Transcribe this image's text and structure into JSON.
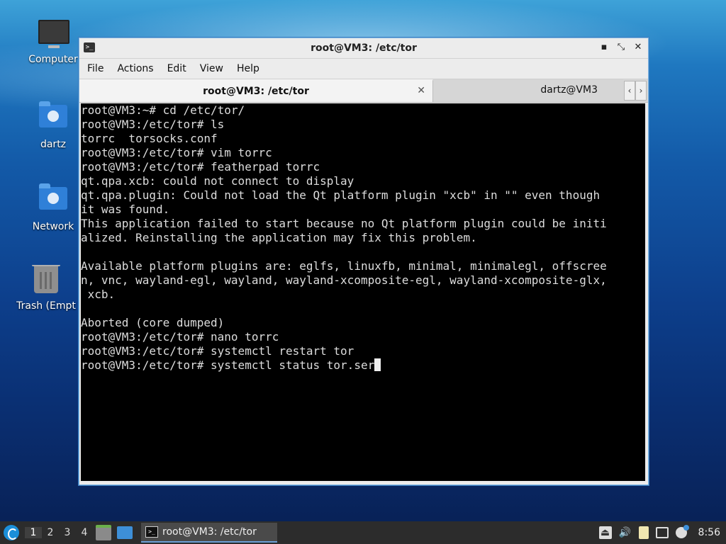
{
  "desktop": {
    "icons": [
      {
        "label": "Computer",
        "icon": "computer-icon"
      },
      {
        "label": "dartz",
        "icon": "home-folder-icon"
      },
      {
        "label": "Network",
        "icon": "network-folder-icon"
      },
      {
        "label": "Trash (Empt",
        "icon": "trash-icon"
      }
    ]
  },
  "window": {
    "title": "root@VM3: /etc/tor",
    "title_icon": ">_",
    "controls": {
      "minimize": "▪",
      "maximize": "⤡",
      "close": "✕"
    },
    "menu": [
      "File",
      "Actions",
      "Edit",
      "View",
      "Help"
    ],
    "tabs": [
      {
        "label": "root@VM3: /etc/tor",
        "close": "✕",
        "active": true
      },
      {
        "label": "dartz@VM3",
        "active": false
      }
    ],
    "tab_scroll": {
      "left": "‹",
      "right": "›"
    }
  },
  "terminal": {
    "lines": [
      "root@VM3:~# cd /etc/tor/",
      "root@VM3:/etc/tor# ls",
      "torrc  torsocks.conf",
      "root@VM3:/etc/tor# vim torrc",
      "root@VM3:/etc/tor# featherpad torrc",
      "qt.qpa.xcb: could not connect to display",
      "qt.qpa.plugin: Could not load the Qt platform plugin \"xcb\" in \"\" even though",
      "it was found.",
      "This application failed to start because no Qt platform plugin could be initi",
      "alized. Reinstalling the application may fix this problem.",
      "",
      "Available platform plugins are: eglfs, linuxfb, minimal, minimalegl, offscree",
      "n, vnc, wayland-egl, wayland, wayland-xcomposite-egl, wayland-xcomposite-glx,",
      " xcb.",
      "",
      "Aborted (core dumped)",
      "root@VM3:/etc/tor# nano torrc",
      "root@VM3:/etc/tor# systemctl restart tor"
    ],
    "current_line": "root@VM3:/etc/tor# systemctl status tor.ser"
  },
  "taskbar": {
    "workspaces": [
      "1",
      "2",
      "3",
      "4"
    ],
    "active_workspace": "1",
    "task": {
      "label": "root@VM3: /etc/tor",
      "icon": ">_"
    },
    "tray": {
      "icons": [
        "eject-icon",
        "volume-icon",
        "clipboard-icon",
        "network-icon",
        "update-icon"
      ],
      "volume_glyph": "🔊",
      "eject_glyph": "⏏",
      "clock": "8:56"
    }
  }
}
